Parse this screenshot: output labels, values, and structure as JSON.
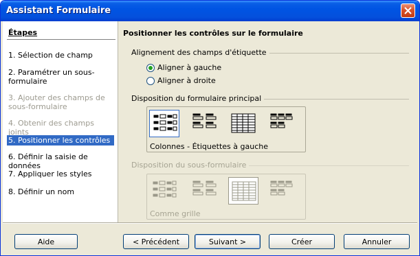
{
  "window": {
    "title": "Assistant Formulaire"
  },
  "steps": {
    "heading": "Étapes",
    "items": [
      {
        "label": "1. Sélection de champ",
        "state": "normal"
      },
      {
        "label": "2. Paramétrer un sous-formulaire",
        "state": "normal"
      },
      {
        "label": "3. Ajouter des champs de sous-formulaire",
        "state": "disabled"
      },
      {
        "label": "4. Obtenir des champs joints",
        "state": "disabled"
      },
      {
        "label": "5. Positionner les contrôles",
        "state": "active"
      },
      {
        "label": "6. Définir la saisie de données",
        "state": "normal"
      },
      {
        "label": "7. Appliquer les styles",
        "state": "normal"
      },
      {
        "label": "8. Définir un nom",
        "state": "normal"
      }
    ]
  },
  "main": {
    "title": "Positionner les contrôles sur le formulaire",
    "label_alignment": {
      "heading": "Alignement des champs d'étiquette",
      "options": [
        {
          "label": "Aligner à gauche",
          "checked": true
        },
        {
          "label": "Aligner à droite",
          "checked": false
        }
      ]
    },
    "main_layout": {
      "heading": "Disposition du formulaire principal",
      "caption": "Colonnes - Étiquettes à gauche",
      "selected_index": 0
    },
    "sub_layout": {
      "heading": "Disposition du sous-formulaire",
      "caption": "Comme grille",
      "selected_index": 2,
      "disabled": true
    }
  },
  "buttons": {
    "help": "Aide",
    "back": "< Précédent",
    "next": "Suivant >",
    "finish": "Créer",
    "cancel": "Annuler"
  },
  "colors": {
    "title_bar": "#0054e3",
    "selection": "#316ac5",
    "dialog_bg": "#ece9d8",
    "radio_check": "#21a121"
  }
}
